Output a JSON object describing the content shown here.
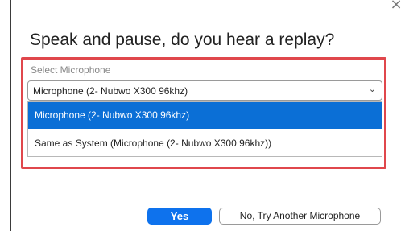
{
  "dialog": {
    "close_glyph": "×",
    "title": "Speak and pause, do you hear a replay?",
    "select_label": "Select Microphone",
    "selected_value": "Microphone (2- Nubwo X300  96khz)",
    "chevron_glyph": "⌄",
    "options": [
      "Microphone (2- Nubwo X300  96khz)",
      "Same as System (Microphone (2- Nubwo X300  96khz))"
    ],
    "yes_label": "Yes",
    "no_label": "No, Try Another Microphone"
  },
  "colors": {
    "highlight_border": "#e0474c",
    "selected_option_bg": "#0b6fd6",
    "primary_button": "#0e72ed"
  }
}
